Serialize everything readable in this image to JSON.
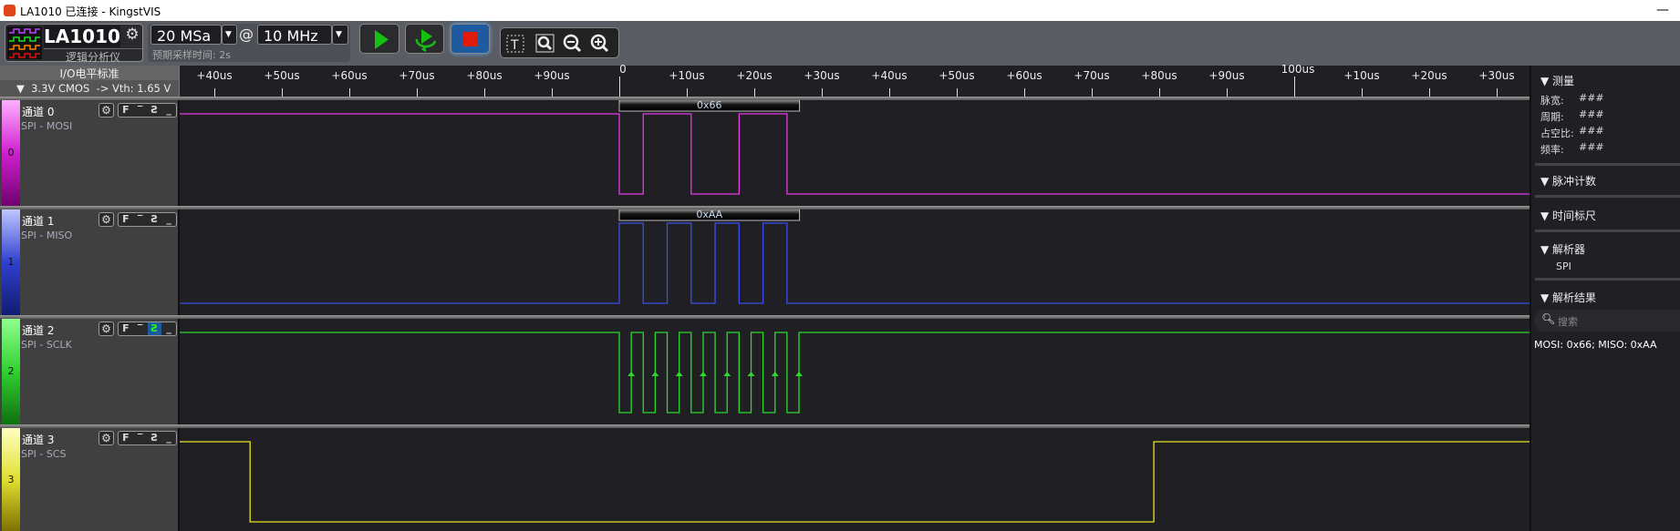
{
  "window": {
    "title": "LA1010 已连接 - KingstVIS",
    "minimize": "—"
  },
  "device": {
    "name": "LA1010",
    "subtitle": "逻辑分析仪",
    "gear": "⚙"
  },
  "sampling": {
    "depth": "20 MSa",
    "at": "@",
    "rate": "10 MHz",
    "hint": "预期采样时间: 2s"
  },
  "buttons": [
    "play",
    "loop-play",
    "stop",
    "text-select",
    "zoom-fit",
    "zoom-out",
    "zoom-in"
  ],
  "io": {
    "header": "I/O电平标准",
    "value": "▼  3.3V CMOS  -> Vth: 1.65 V"
  },
  "colors": {
    "accent": "#1e5aa0",
    "play": "#15c015",
    "stop": "#e01b0b"
  },
  "ruler": {
    "ticks": [
      {
        "t": -60,
        "label": "+40us"
      },
      {
        "t": -50,
        "label": "+50us"
      },
      {
        "t": -40,
        "label": "+60us"
      },
      {
        "t": -30,
        "label": "+70us"
      },
      {
        "t": -20,
        "label": "+80us"
      },
      {
        "t": -10,
        "label": "+90us"
      },
      {
        "t": 0,
        "label": "0",
        "major": true
      },
      {
        "t": 10,
        "label": "+10us"
      },
      {
        "t": 20,
        "label": "+20us"
      },
      {
        "t": 30,
        "label": "+30us"
      },
      {
        "t": 40,
        "label": "+40us"
      },
      {
        "t": 50,
        "label": "+50us"
      },
      {
        "t": 60,
        "label": "+60us"
      },
      {
        "t": 70,
        "label": "+70us"
      },
      {
        "t": 80,
        "label": "+80us"
      },
      {
        "t": 90,
        "label": "+90us"
      },
      {
        "t": 100,
        "label": "100us",
        "major": true
      },
      {
        "t": 110,
        "label": "+10us"
      },
      {
        "t": 120,
        "label": "+20us"
      },
      {
        "t": 130,
        "label": "+30us"
      }
    ]
  },
  "channels": [
    {
      "num": "0",
      "name": "通道 0",
      "sub": "SPI - MOSI",
      "color": "#e53ae5",
      "strip": [
        "#ffb0ff",
        "#d020d0",
        "#700070"
      ],
      "init": 1,
      "edges": [
        0,
        3.55,
        10.65,
        17.75,
        24.85
      ],
      "decode": {
        "label": "0x66",
        "start": 0,
        "end": 26.7
      },
      "trigger_active": null
    },
    {
      "num": "1",
      "name": "通道 1",
      "sub": "SPI - MISO",
      "color": "#3a4fe8",
      "strip": [
        "#c0c8ff",
        "#3040d0",
        "#101c70"
      ],
      "init": 0,
      "edges": [
        0,
        3.55,
        7.1,
        10.65,
        14.2,
        17.75,
        21.3,
        24.85
      ],
      "decode": {
        "label": "0xAA",
        "start": 0,
        "end": 26.7
      },
      "trigger_active": null
    },
    {
      "num": "2",
      "name": "通道 2",
      "sub": "SPI - SCLK",
      "color": "#2ed82e",
      "strip": [
        "#90ff90",
        "#30d030",
        "#107010"
      ],
      "init": 1,
      "edges": [
        0,
        1.78,
        3.55,
        5.33,
        7.1,
        8.88,
        10.65,
        12.43,
        14.2,
        15.98,
        17.75,
        19.53,
        21.3,
        23.08,
        24.85,
        26.63
      ],
      "arrows": true,
      "trigger_active": 2
    },
    {
      "num": "3",
      "name": "通道 3",
      "sub": "SPI - SCS",
      "color": "#e6e620",
      "strip": [
        "#ffffc0",
        "#e0e030",
        "#807000"
      ],
      "init": 1,
      "edges": [
        -54.7,
        79.2
      ],
      "trigger_active": null
    }
  ],
  "trigger_icons": [
    "↗rising",
    "‾high",
    "↘falling",
    "_low"
  ],
  "right_panel": {
    "measure": {
      "title": "测量",
      "rows": [
        {
          "k": "脉宽:",
          "v": "###"
        },
        {
          "k": "周期:",
          "v": "###"
        },
        {
          "k": "占空比:",
          "v": "###"
        },
        {
          "k": "频率:",
          "v": "###"
        }
      ]
    },
    "pulse": {
      "title": "脉冲计数"
    },
    "timeruler": {
      "title": "时间标尺"
    },
    "analyzer": {
      "title": "解析器",
      "item": "SPI"
    },
    "results": {
      "title": "解析结果",
      "search_placeholder": "搜索",
      "text": "MOSI: 0x66;  MISO: 0xAA"
    }
  }
}
